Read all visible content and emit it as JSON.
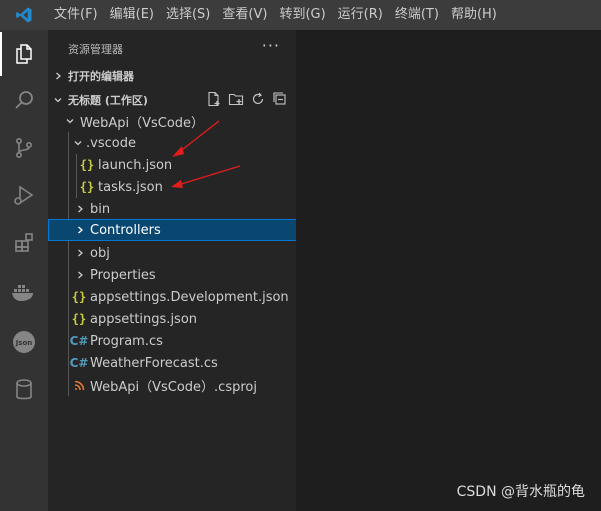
{
  "menu": [
    "文件(F)",
    "编辑(E)",
    "选择(S)",
    "查看(V)",
    "转到(G)",
    "运行(R)",
    "终端(T)",
    "帮助(H)"
  ],
  "sidebar": {
    "title": "资源管理器",
    "more": "···",
    "open_editors": "打开的编辑器",
    "workspace": "无标题 (工作区)",
    "project": "WebApi（VsCode）",
    "vscode_folder": ".vscode",
    "items": [
      {
        "label": "launch.json"
      },
      {
        "label": "tasks.json"
      },
      {
        "label": "bin"
      },
      {
        "label": "Controllers"
      },
      {
        "label": "obj"
      },
      {
        "label": "Properties"
      },
      {
        "label": "appsettings.Development.json"
      },
      {
        "label": "appsettings.json"
      },
      {
        "label": "Program.cs"
      },
      {
        "label": "WeatherForecast.cs"
      },
      {
        "label": "WebApi（VsCode）.csproj"
      }
    ]
  },
  "icons": {
    "json": "{}",
    "cs": "C#",
    "docker_label": "Json"
  },
  "watermark": "CSDN @背水瓶的龟",
  "colors": {
    "accent": "#0078d4",
    "selected": "#094771",
    "arrow": "#e51c1c"
  }
}
